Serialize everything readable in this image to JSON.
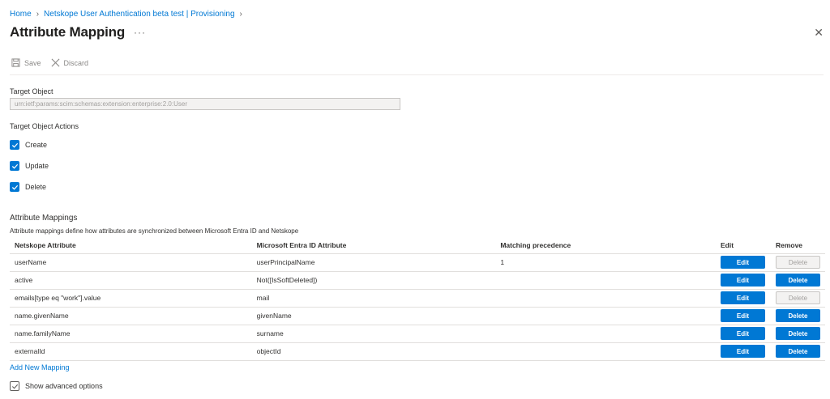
{
  "breadcrumb": {
    "items": [
      "Home",
      "Netskope User Authentication beta test | Provisioning"
    ]
  },
  "page": {
    "title": "Attribute Mapping",
    "more_glyph": "···",
    "close_glyph": "✕"
  },
  "toolbar": {
    "save_label": "Save",
    "discard_label": "Discard"
  },
  "target_object": {
    "label": "Target Object",
    "value": "urn:ietf:params:scim:schemas:extension:enterprise:2.0:User"
  },
  "target_actions": {
    "label": "Target Object Actions",
    "items": [
      {
        "label": "Create",
        "checked": true
      },
      {
        "label": "Update",
        "checked": true
      },
      {
        "label": "Delete",
        "checked": true
      }
    ]
  },
  "mappings": {
    "title": "Attribute Mappings",
    "description": "Attribute mappings define how attributes are synchronized between Microsoft Entra ID and Netskope",
    "columns": [
      "Netskope Attribute",
      "Microsoft Entra ID Attribute",
      "Matching precedence",
      "Edit",
      "Remove"
    ],
    "edit_label": "Edit",
    "delete_label": "Delete",
    "rows": [
      {
        "target": "userName",
        "source": "userPrincipalName",
        "precedence": "1",
        "delete_enabled": false
      },
      {
        "target": "active",
        "source": "Not([IsSoftDeleted])",
        "precedence": "",
        "delete_enabled": true
      },
      {
        "target": "emails[type eq \"work\"].value",
        "source": "mail",
        "precedence": "",
        "delete_enabled": false
      },
      {
        "target": "name.givenName",
        "source": "givenName",
        "precedence": "",
        "delete_enabled": true
      },
      {
        "target": "name.familyName",
        "source": "surname",
        "precedence": "",
        "delete_enabled": true
      },
      {
        "target": "externalId",
        "source": "objectId",
        "precedence": "",
        "delete_enabled": true
      }
    ],
    "add_label": "Add New Mapping"
  },
  "advanced": {
    "label": "Show advanced options",
    "checked": false
  },
  "colors": {
    "accent": "#0078d4",
    "text": "#323130",
    "disabled_bg": "#f3f2f1",
    "disabled_text": "#a19f9d"
  }
}
